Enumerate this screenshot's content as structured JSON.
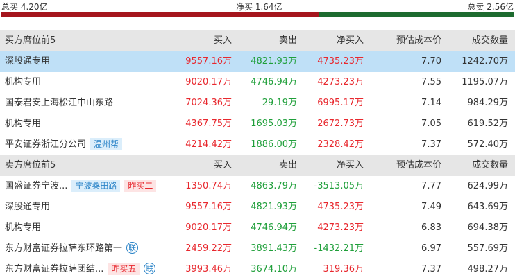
{
  "summary": {
    "total_buy": "总买 4.20亿",
    "net_buy": "净买 1.64亿",
    "total_sell": "总卖 2.56亿",
    "buy_ratio": 0.62,
    "colors": {
      "buy": "#a5151d",
      "sell": "#1d6b2f"
    }
  },
  "buy_section": {
    "headers": [
      "买方席位前5",
      "买入",
      "卖出",
      "净买入",
      "预估成本价",
      "成交数量"
    ],
    "rows": [
      {
        "name": "深股通专用",
        "buy": "9557.16万",
        "sell": "4821.93万",
        "net": "4735.23万",
        "cost": "7.70",
        "volume": "1242.70万"
      },
      {
        "name": "机构专用",
        "buy": "9020.17万",
        "sell": "4746.94万",
        "net": "4273.23万",
        "cost": "7.55",
        "volume": "1195.07万"
      },
      {
        "name": "国泰君安上海松江中山东路",
        "buy": "7024.36万",
        "sell": "29.19万",
        "net": "6995.17万",
        "cost": "7.14",
        "volume": "984.29万"
      },
      {
        "name": "机构专用",
        "buy": "4367.75万",
        "sell": "1695.03万",
        "net": "2672.73万",
        "cost": "7.05",
        "volume": "619.52万"
      },
      {
        "name": "平安证券浙江分公司",
        "tag": "温州帮",
        "buy": "4214.42万",
        "sell": "1886.00万",
        "net": "2328.42万",
        "cost": "7.37",
        "volume": "572.40万"
      }
    ]
  },
  "sell_section": {
    "headers": [
      "卖方席位前5",
      "买入",
      "卖出",
      "净买入",
      "预估成本价",
      "成交数量"
    ],
    "rows": [
      {
        "name": "国盛证券宁波...",
        "tag": "宁波桑田路",
        "tag2": "昨买二",
        "buy": "1350.74万",
        "sell": "4863.79万",
        "net": "-3513.05万",
        "cost": "7.77",
        "volume": "624.99万"
      },
      {
        "name": "深股通专用",
        "buy": "9557.16万",
        "sell": "4821.93万",
        "net": "4735.23万",
        "cost": "7.49",
        "volume": "643.69万"
      },
      {
        "name": "机构专用",
        "buy": "9020.17万",
        "sell": "4746.94万",
        "net": "4273.23万",
        "cost": "6.83",
        "volume": "694.38万"
      },
      {
        "name": "东方财富证券拉萨东环路第一",
        "badge": "联",
        "buy": "2459.22万",
        "sell": "3891.43万",
        "net": "-1432.21万",
        "cost": "6.97",
        "volume": "557.69万"
      },
      {
        "name": "东方财富证券拉萨团结...",
        "tag2": "昨买五",
        "badge": "联",
        "buy": "3993.46万",
        "sell": "3674.10万",
        "net": "319.36万",
        "cost": "7.37",
        "volume": "498.27万"
      }
    ]
  }
}
